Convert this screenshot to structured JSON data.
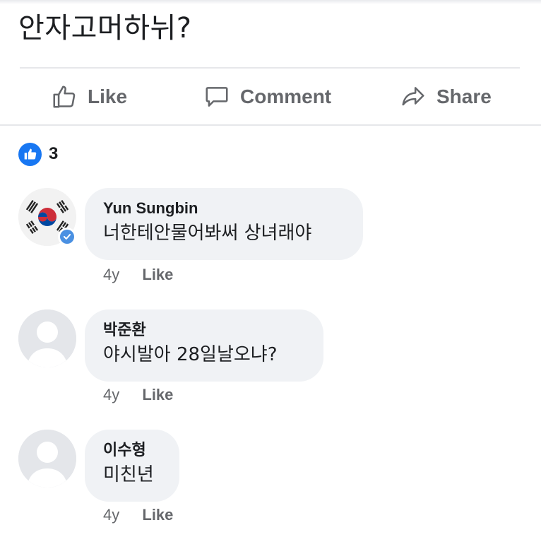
{
  "post": {
    "text": "안자고머하뉘?"
  },
  "actions": {
    "like_label": "Like",
    "comment_label": "Comment",
    "share_label": "Share"
  },
  "reactions": {
    "count": "3",
    "icon": "thumbs-up-icon",
    "color": "#1877f2"
  },
  "comments": [
    {
      "author": "Yun Sungbin",
      "text": "너한테안물어봐써 상녀래야",
      "time": "4y",
      "like_label": "Like",
      "verified": true
    },
    {
      "author": "박준환",
      "text": "야시발아 28일날오냐?",
      "time": "4y",
      "like_label": "Like",
      "verified": false
    },
    {
      "author": "이수형",
      "text": "미친년",
      "time": "4y",
      "like_label": "Like",
      "verified": false
    }
  ]
}
